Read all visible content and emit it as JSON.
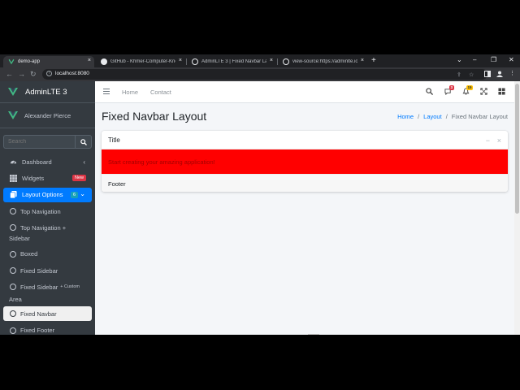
{
  "browser": {
    "tabs": [
      {
        "label": "demo-app",
        "active": true
      },
      {
        "label": "GitHub - Khmer-Computer-Kno…",
        "active": false
      },
      {
        "label": "AdminLTE 3 | Fixed Navbar Layo…",
        "active": false
      },
      {
        "label": "view-source:https://adminlte.io/t…",
        "active": false
      }
    ],
    "url": "localhost:8080",
    "newtab_glyph": "+",
    "close_glyph": "×"
  },
  "sidebar": {
    "brand": "AdminLTE 3",
    "user": "Alexander Pierce",
    "search_placeholder": "Search",
    "items": [
      {
        "label": "Dashboard",
        "icon": "dashboard-icon",
        "chevron": "‹"
      },
      {
        "label": "Widgets",
        "icon": "th-icon",
        "badge": "New"
      },
      {
        "label": "Layout Options",
        "icon": "copy-icon",
        "badge": "6",
        "chevron": "⌄"
      },
      {
        "label": "Top Navigation",
        "icon": "circle-icon"
      },
      {
        "label": "Top Navigation +",
        "label2": "Sidebar",
        "icon": "circle-icon"
      },
      {
        "label": "Boxed",
        "icon": "circle-icon"
      },
      {
        "label": "Fixed Sidebar",
        "icon": "circle-icon"
      },
      {
        "label": "Fixed Sidebar",
        "small": "+ Custom",
        "label2": "Area",
        "icon": "circle-icon"
      },
      {
        "label": "Fixed Navbar",
        "icon": "circle-icon"
      },
      {
        "label": "Fixed Footer",
        "icon": "circle-icon"
      }
    ]
  },
  "navbar": {
    "links": [
      "Home",
      "Contact"
    ],
    "messages_badge": "3",
    "notifications_badge": "15"
  },
  "page": {
    "title": "Fixed Navbar Layout",
    "breadcrumb": [
      "Home",
      "Layout",
      "Fixed Navbar Layout"
    ],
    "breadcrumb_sep": "/"
  },
  "card": {
    "title": "Title",
    "body": "Start creating your amazing application!",
    "footer": "Footer",
    "collapse_glyph": "−",
    "remove_glyph": "×"
  },
  "colors": {
    "sidebar_bg": "#343a40",
    "active_item": "#007bff",
    "card_body": "#ff0000",
    "vue_green": "#41b883"
  }
}
